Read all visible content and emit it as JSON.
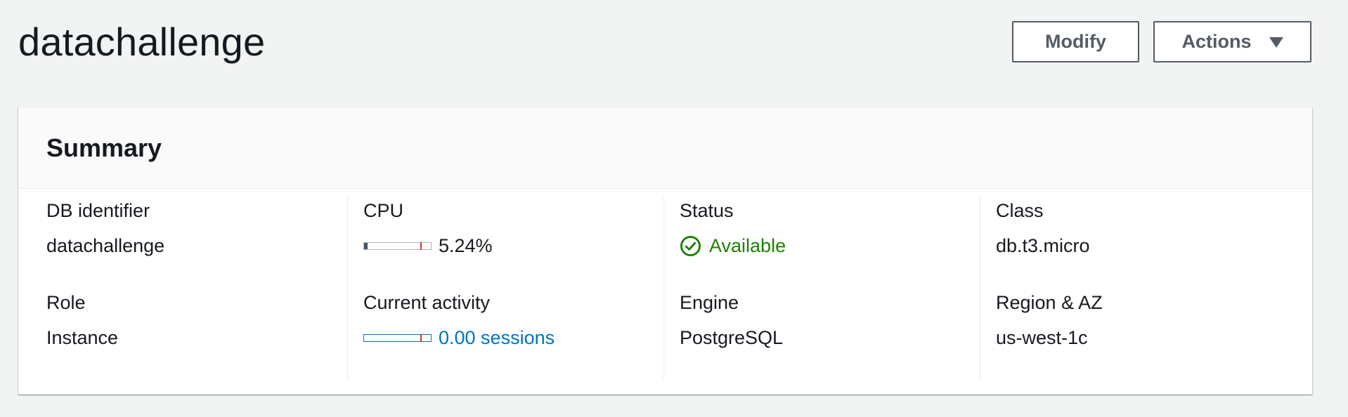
{
  "header": {
    "title": "datachallenge",
    "modify_label": "Modify",
    "actions_label": "Actions"
  },
  "summary": {
    "title": "Summary",
    "db_identifier": {
      "label": "DB identifier",
      "value": "datachallenge"
    },
    "role": {
      "label": "Role",
      "value": "Instance"
    },
    "cpu": {
      "label": "CPU",
      "value": "5.24%",
      "percent": 5.24
    },
    "current_activity": {
      "label": "Current activity",
      "value": "0.00 sessions",
      "sessions": 0.0
    },
    "status": {
      "label": "Status",
      "value": "Available",
      "icon": "check-circle-icon"
    },
    "engine": {
      "label": "Engine",
      "value": "PostgreSQL"
    },
    "class": {
      "label": "Class",
      "value": "db.t3.micro"
    },
    "region_az": {
      "label": "Region & AZ",
      "value": "us-west-1c"
    }
  },
  "colors": {
    "background": "#f2f3f3",
    "text": "#16191f",
    "button_border": "#545b64",
    "link": "#0073bb",
    "success": "#1d8102",
    "threshold": "#d13212",
    "meter_fill": "#44546a"
  }
}
